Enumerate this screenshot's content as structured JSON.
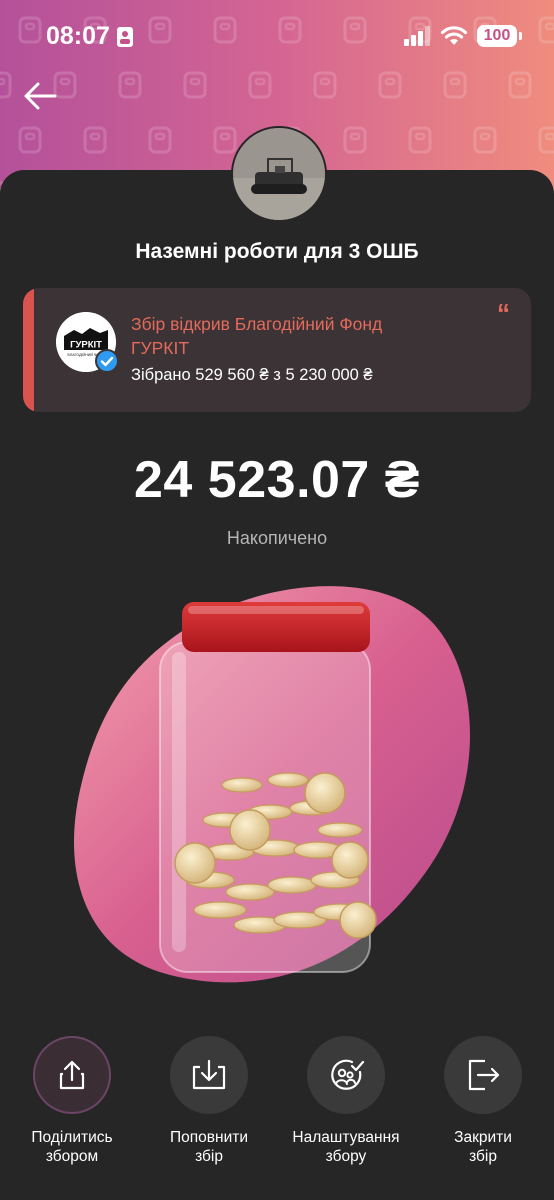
{
  "status": {
    "time": "08:07",
    "battery": "100"
  },
  "jar": {
    "title": "Наземні роботи для 3 ОШБ",
    "amount": "24 523.07 ₴",
    "amount_caption": "Накопичено"
  },
  "organizer": {
    "opened_by": "Збір відкрив Благодійний Фонд ГУРКІТ",
    "raised": "Зібрано 529 560 ₴ з 5 230 000 ₴",
    "logo_text": "ГУРКІТ",
    "logo_subtext": "БЛАГОДІЙНИЙ ФОНД"
  },
  "actions": [
    {
      "label": "Поділитись\nзбором",
      "icon": "share-icon"
    },
    {
      "label": "Поповнити\nзбір",
      "icon": "top-up-icon"
    },
    {
      "label": "Налаштування\nзбору",
      "icon": "settings-icon"
    },
    {
      "label": "Закрити\nзбір",
      "icon": "close-jar-icon"
    }
  ],
  "colors": {
    "accent": "#e46a5c",
    "background": "#262626",
    "header_gradient_start": "#b4519a",
    "header_gradient_end": "#ef8c7e"
  }
}
